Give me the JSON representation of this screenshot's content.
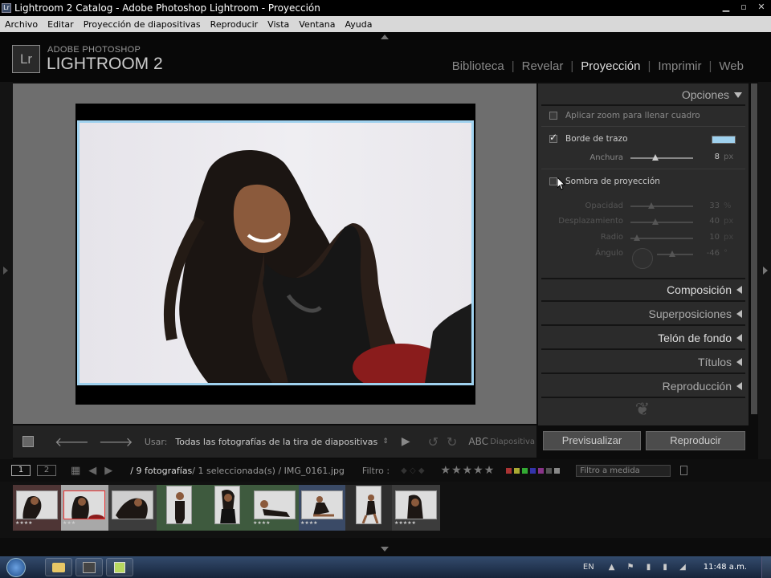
{
  "window": {
    "title": "Lightroom 2 Catalog - Adobe Photoshop Lightroom - Proyección"
  },
  "menu": [
    "Archivo",
    "Editar",
    "Proyección de diapositivas",
    "Reproducir",
    "Vista",
    "Ventana",
    "Ayuda"
  ],
  "brand": {
    "logo": "Lr",
    "line1": "ADOBE PHOTOSHOP",
    "line2": "LIGHTROOM 2"
  },
  "modules": [
    "Biblioteca",
    "Revelar",
    "Proyección",
    "Imprimir",
    "Web"
  ],
  "active_module": "Proyección",
  "panel": {
    "opciones": {
      "title": "Opciones",
      "zoom_label": "Aplicar zoom para llenar cuadro",
      "zoom_checked": false,
      "borde_label": "Borde de trazo",
      "borde_checked": true,
      "borde_color": "#9fd1ee",
      "anchura_label": "Anchura",
      "anchura_value": "8",
      "anchura_fraction": 0.4,
      "px": "px",
      "sombra_label": "Sombra de proyección",
      "sombra_checked": false,
      "opacidad_label": "Opacidad",
      "opacidad_value": "33",
      "opacidad_unit": "%",
      "opacidad_fraction": 0.33,
      "desplazamiento_label": "Desplazamiento",
      "desplazamiento_value": "40",
      "desplazamiento_unit": "px",
      "desplazamiento_fraction": 0.4,
      "radio_label": "Radio",
      "radio_value": "10",
      "radio_unit": "px",
      "radio_fraction": 0.1,
      "angulo_label": "Ángulo",
      "angulo_value": "-46",
      "angulo_unit": "°",
      "angulo_fraction": 0.43
    },
    "sections": [
      "Composición",
      "Superposiciones",
      "Telón de fondo",
      "Títulos",
      "Reproducción"
    ],
    "buttons": {
      "preview": "Previsualizar",
      "play": "Reproducir"
    }
  },
  "toolbar": {
    "usar_label": "Usar:",
    "usar_value": "Todas las fotografías de la tira de diapositivas",
    "abc": "ABC",
    "right_label": "Diapositiva"
  },
  "filmstrip": {
    "view1": "1",
    "view2": "2",
    "info_count": "/ 9 fotografías",
    "info_selected": " / 1 seleccionada(s) / IMG_0161.jpg",
    "filter_label": "Filtro :",
    "filter_value": "Filtro a medida",
    "thumbs_ratings": [
      "★★★★",
      "★★★",
      "",
      "",
      "",
      "★★★★",
      "★★★★",
      "",
      "★★★★★"
    ]
  },
  "taskbar": {
    "language": "EN",
    "clock": "11:48 a.m."
  }
}
